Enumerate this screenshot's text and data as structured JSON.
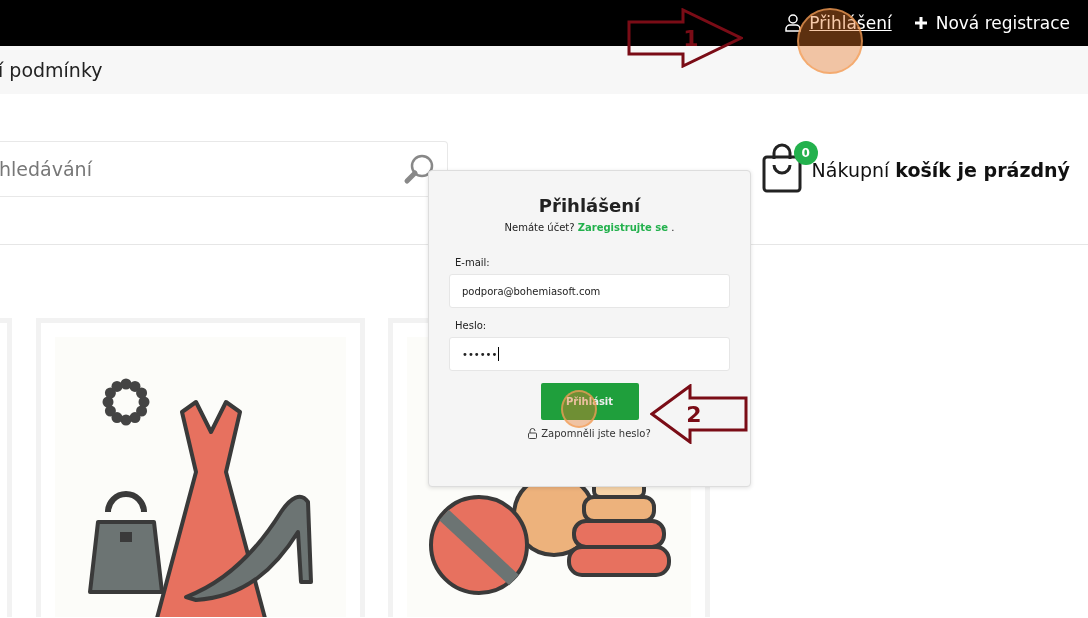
{
  "top_nav": {
    "login_link": "Přihlášení",
    "register_link": "Nová registrace"
  },
  "sub_nav": {
    "menu_item": "í podmínky"
  },
  "search": {
    "placeholder": "hledávání"
  },
  "cart": {
    "count": "0",
    "text": "Nákupní **košík je prázdný**"
  },
  "products": [
    {
      "kind": "partial"
    },
    {
      "kind": "fashion"
    },
    {
      "kind": "toys"
    }
  ],
  "login_dialog": {
    "title": "Přihlášení",
    "prompt": "Nemáte účet?",
    "register_link": "Zaregistrujte se",
    "prompt_end": ".",
    "email_label": "E-mail:",
    "email_value": "podpora@bohemiasoft.com",
    "password_label": "Heslo:",
    "password_value": "••••••",
    "submit": "Přihlásit",
    "forgot_link": "Zapomněli jste heslo?"
  },
  "annotations": [
    {
      "label": "1",
      "kind": "right"
    },
    {
      "label": "2",
      "kind": "left"
    }
  ]
}
